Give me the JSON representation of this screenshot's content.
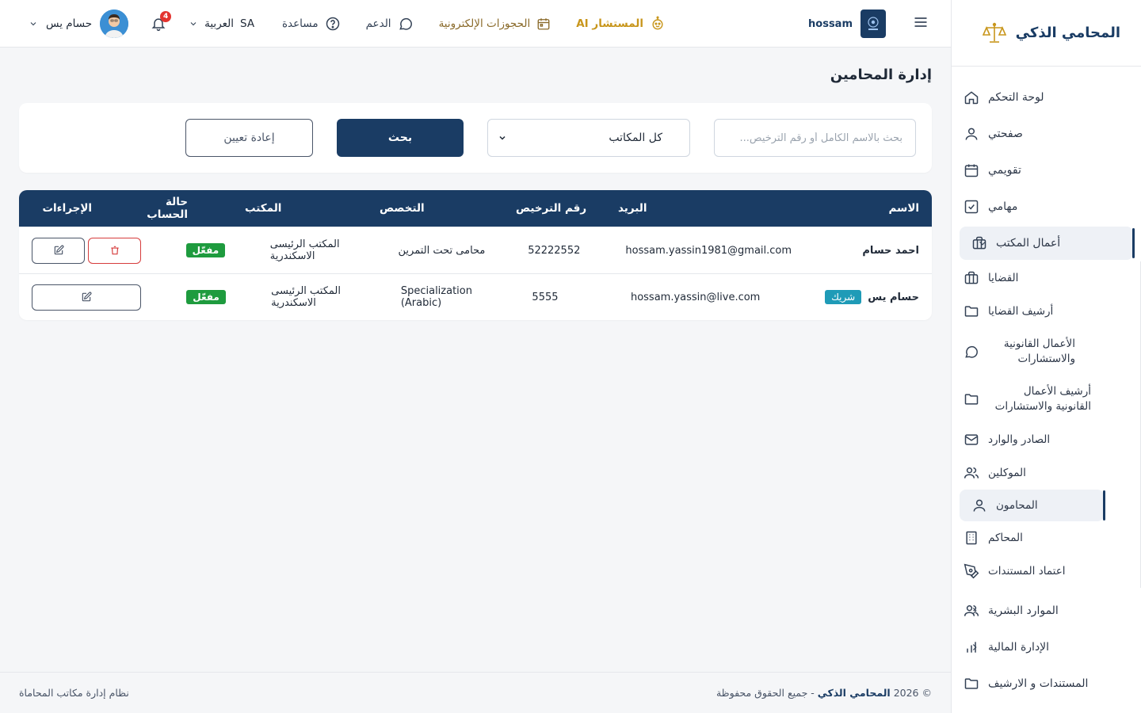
{
  "sidebar": {
    "brand": "المحامي الذكي",
    "items": [
      {
        "label": "لوحة التحكم",
        "icon": "home-icon"
      },
      {
        "label": "صفحتي",
        "icon": "user-icon"
      },
      {
        "label": "تقويمي",
        "icon": "calendar-icon"
      },
      {
        "label": "مهامي",
        "icon": "check-square-icon"
      },
      {
        "label": "أعمال المكتب",
        "icon": "briefcase-icon"
      }
    ],
    "sub_items": [
      {
        "label": "القضايا",
        "icon": "briefcase-icon"
      },
      {
        "label": "أرشيف القضايا",
        "icon": "folder-icon"
      },
      {
        "label": "الأعمال القانونية والاستشارات",
        "icon": "chat-icon"
      },
      {
        "label": "أرشيف الأعمال القانونية والاستشارات",
        "icon": "folder-icon"
      },
      {
        "label": "الصادر والوارد",
        "icon": "mail-icon"
      },
      {
        "label": "الموكلين",
        "icon": "users-icon"
      },
      {
        "label": "المحامون",
        "icon": "user-icon"
      },
      {
        "label": "المحاكم",
        "icon": "building-icon"
      },
      {
        "label": "اعتماد المستندات",
        "icon": "pen-icon"
      }
    ],
    "bottom_items": [
      {
        "label": "الموارد البشرية",
        "icon": "users-icon"
      },
      {
        "label": "الإدارة المالية",
        "icon": "bar-chart-icon"
      },
      {
        "label": "المستندات و الارشيف",
        "icon": "folder-icon"
      }
    ]
  },
  "header": {
    "brand_name": "hossam",
    "links": {
      "ai": "المستشار AI",
      "bookings": "الحجوزات الإلكترونية",
      "support": "الدعم",
      "help": "مساعدة"
    },
    "language": "العربية",
    "language_code": "SA",
    "notifications_count": "4",
    "user_name": "حسام يس"
  },
  "page": {
    "title": "إدارة المحامين"
  },
  "filters": {
    "search_placeholder": "بحث بالاسم الكامل أو رقم الترخيص...",
    "office_select": "كل المكاتب",
    "search_button": "بحث",
    "reset_button": "إعادة تعيين"
  },
  "table": {
    "headers": {
      "name": "الاسم",
      "email": "البريد",
      "license": "رقم الترخيص",
      "specialization": "التخصص",
      "office": "المكتب",
      "status": "حالة الحساب",
      "actions": "الإجراءات"
    },
    "rows": [
      {
        "name": "احمد حسام",
        "badge": "",
        "email": "hossam.yassin1981@gmail.com",
        "license": "52222552",
        "specialization": "محامى تحت التمرين",
        "office": "المكتب الرئيسى الاسكندرية",
        "status": "مفعّل"
      },
      {
        "name": "حسام يس",
        "badge": "شريك",
        "email": "hossam.yassin@live.com",
        "license": "5555",
        "specialization": "Specialization (Arabic)",
        "office": "المكتب الرئيسى الاسكندرية",
        "status": "مفعّل"
      }
    ]
  },
  "footer": {
    "copyright_prefix": "© 2026",
    "copyright_brand": "المحامي الذكي",
    "copyright_suffix": "- جميع الحقوق محفوظة",
    "system_name": "نظام إدارة مكاتب المحاماة"
  },
  "colors": {
    "primary": "#1a3c64",
    "accent_gold": "#c8961c",
    "active_green": "#1e9b3e",
    "partner_teal": "#1f9bb7",
    "danger": "#d63c3c"
  }
}
